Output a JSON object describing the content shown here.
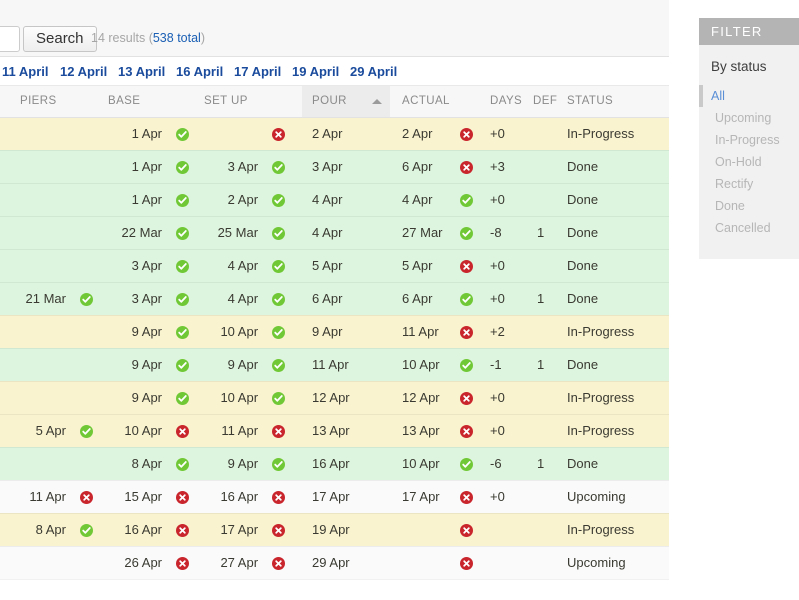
{
  "search": {
    "input_value": "",
    "input_placeholder": "",
    "button_label": "Search",
    "results_count_label": "14 results",
    "total_prefix": "(",
    "total_link_label": "538 total",
    "total_suffix": ")"
  },
  "date_nav": {
    "links": [
      {
        "label": "11 April"
      },
      {
        "label": "12 April"
      },
      {
        "label": "13 April"
      },
      {
        "label": "16 April"
      },
      {
        "label": "17 April"
      },
      {
        "label": "19 April"
      },
      {
        "label": "29 April"
      }
    ]
  },
  "table": {
    "sorted_column": "POUR",
    "sort_direction": "asc",
    "headers": {
      "piers": "PIERS",
      "base": "BASE",
      "setup": "SET UP",
      "pour": "POUR",
      "actual": "ACTUAL",
      "days": "DAYS",
      "def": "DEF",
      "status": "STATUS"
    },
    "rows": [
      {
        "piers": "",
        "piers_icon": "",
        "base": "1 Apr",
        "base_icon": "ok",
        "setup": "",
        "setup_icon": "bad",
        "pour": "2 Apr",
        "actual": "2 Apr",
        "actual_icon": "bad",
        "days": "+0",
        "def": "",
        "status": "In-Progress",
        "row_state": "progress"
      },
      {
        "piers": "",
        "piers_icon": "",
        "base": "1 Apr",
        "base_icon": "ok",
        "setup": "3 Apr",
        "setup_icon": "ok",
        "pour": "3 Apr",
        "actual": "6 Apr",
        "actual_icon": "bad",
        "days": "+3",
        "def": "",
        "status": "Done",
        "row_state": "done"
      },
      {
        "piers": "",
        "piers_icon": "",
        "base": "1 Apr",
        "base_icon": "ok",
        "setup": "2 Apr",
        "setup_icon": "ok",
        "pour": "4 Apr",
        "actual": "4 Apr",
        "actual_icon": "ok",
        "days": "+0",
        "def": "",
        "status": "Done",
        "row_state": "done"
      },
      {
        "piers": "",
        "piers_icon": "",
        "base": "22 Mar",
        "base_icon": "ok",
        "setup": "25 Mar",
        "setup_icon": "ok",
        "pour": "4 Apr",
        "actual": "27 Mar",
        "actual_icon": "ok",
        "days": "-8",
        "def": "1",
        "status": "Done",
        "row_state": "done"
      },
      {
        "piers": "",
        "piers_icon": "",
        "base": "3 Apr",
        "base_icon": "ok",
        "setup": "4 Apr",
        "setup_icon": "ok",
        "pour": "5 Apr",
        "actual": "5 Apr",
        "actual_icon": "bad",
        "days": "+0",
        "def": "",
        "status": "Done",
        "row_state": "done"
      },
      {
        "piers": "21 Mar",
        "piers_icon": "ok",
        "base": "3 Apr",
        "base_icon": "ok",
        "setup": "4 Apr",
        "setup_icon": "ok",
        "pour": "6 Apr",
        "actual": "6 Apr",
        "actual_icon": "ok",
        "days": "+0",
        "def": "1",
        "status": "Done",
        "row_state": "done"
      },
      {
        "piers": "",
        "piers_icon": "",
        "base": "9 Apr",
        "base_icon": "ok",
        "setup": "10 Apr",
        "setup_icon": "ok",
        "pour": "9 Apr",
        "actual": "11 Apr",
        "actual_icon": "bad",
        "days": "+2",
        "def": "",
        "status": "In-Progress",
        "row_state": "progress"
      },
      {
        "piers": "",
        "piers_icon": "",
        "base": "9 Apr",
        "base_icon": "ok",
        "setup": "9 Apr",
        "setup_icon": "ok",
        "pour": "11 Apr",
        "actual": "10 Apr",
        "actual_icon": "ok",
        "days": "-1",
        "def": "1",
        "status": "Done",
        "row_state": "done"
      },
      {
        "piers": "",
        "piers_icon": "",
        "base": "9 Apr",
        "base_icon": "ok",
        "setup": "10 Apr",
        "setup_icon": "ok",
        "pour": "12 Apr",
        "actual": "12 Apr",
        "actual_icon": "bad",
        "days": "+0",
        "def": "",
        "status": "In-Progress",
        "row_state": "progress"
      },
      {
        "piers": "5 Apr",
        "piers_icon": "ok",
        "base": "10 Apr",
        "base_icon": "bad",
        "setup": "11 Apr",
        "setup_icon": "bad",
        "pour": "13 Apr",
        "actual": "13 Apr",
        "actual_icon": "bad",
        "days": "+0",
        "def": "",
        "status": "In-Progress",
        "row_state": "progress"
      },
      {
        "piers": "",
        "piers_icon": "",
        "base": "8 Apr",
        "base_icon": "ok",
        "setup": "9 Apr",
        "setup_icon": "ok",
        "pour": "16 Apr",
        "actual": "10 Apr",
        "actual_icon": "ok",
        "days": "-6",
        "def": "1",
        "status": "Done",
        "row_state": "done"
      },
      {
        "piers": "11 Apr",
        "piers_icon": "bad",
        "base": "15 Apr",
        "base_icon": "bad",
        "setup": "16 Apr",
        "setup_icon": "bad",
        "pour": "17 Apr",
        "actual": "17 Apr",
        "actual_icon": "bad",
        "days": "+0",
        "def": "",
        "status": "Upcoming",
        "row_state": "upcoming"
      },
      {
        "piers": "8 Apr",
        "piers_icon": "ok",
        "base": "16 Apr",
        "base_icon": "bad",
        "setup": "17 Apr",
        "setup_icon": "bad",
        "pour": "19 Apr",
        "actual": "",
        "actual_icon": "bad",
        "days": "",
        "def": "",
        "status": "In-Progress",
        "row_state": "progress"
      },
      {
        "piers": "",
        "piers_icon": "",
        "base": "26 Apr",
        "base_icon": "bad",
        "setup": "27 Apr",
        "setup_icon": "bad",
        "pour": "29 Apr",
        "actual": "",
        "actual_icon": "bad",
        "days": "",
        "def": "",
        "status": "Upcoming",
        "row_state": "upcoming"
      }
    ]
  },
  "filter": {
    "header_label": "FILTER",
    "group_title": "By status",
    "items": [
      {
        "label": "All",
        "active": true
      },
      {
        "label": "Upcoming",
        "active": false
      },
      {
        "label": "In-Progress",
        "active": false
      },
      {
        "label": "On-Hold",
        "active": false
      },
      {
        "label": "Rectify",
        "active": false
      },
      {
        "label": "Done",
        "active": false
      },
      {
        "label": "Cancelled",
        "active": false
      }
    ]
  },
  "colors": {
    "link": "#1a4b9c",
    "ok_badge": "#71c837",
    "bad_badge": "#c9252c",
    "row_done": "#ddf5de",
    "row_progress": "#faf3cf",
    "row_upcoming": "#fafafa",
    "filter_header_bg": "#b4b4b4",
    "filter_active_text": "#5a8fd6"
  }
}
